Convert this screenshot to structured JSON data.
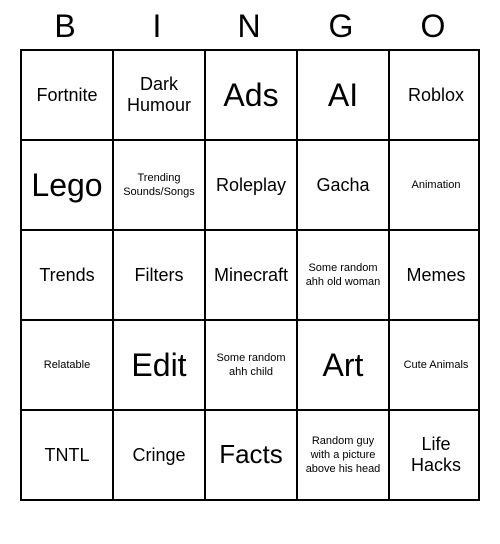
{
  "header": {
    "letters": [
      "B",
      "I",
      "N",
      "G",
      "O"
    ]
  },
  "grid": [
    [
      {
        "text": "Fortnite",
        "size": "medium"
      },
      {
        "text": "Dark Humour",
        "size": "medium"
      },
      {
        "text": "Ads",
        "size": "xlarge"
      },
      {
        "text": "AI",
        "size": "xlarge"
      },
      {
        "text": "Roblox",
        "size": "medium"
      }
    ],
    [
      {
        "text": "Lego",
        "size": "xlarge"
      },
      {
        "text": "Trending Sounds/Songs",
        "size": "small"
      },
      {
        "text": "Roleplay",
        "size": "medium"
      },
      {
        "text": "Gacha",
        "size": "medium"
      },
      {
        "text": "Animation",
        "size": "small"
      }
    ],
    [
      {
        "text": "Trends",
        "size": "medium"
      },
      {
        "text": "Filters",
        "size": "medium"
      },
      {
        "text": "Minecraft",
        "size": "medium"
      },
      {
        "text": "Some random ahh old woman",
        "size": "small"
      },
      {
        "text": "Memes",
        "size": "medium"
      }
    ],
    [
      {
        "text": "Relatable",
        "size": "small"
      },
      {
        "text": "Edit",
        "size": "xlarge"
      },
      {
        "text": "Some random ahh child",
        "size": "small"
      },
      {
        "text": "Art",
        "size": "xlarge"
      },
      {
        "text": "Cute Animals",
        "size": "small"
      }
    ],
    [
      {
        "text": "TNTL",
        "size": "medium"
      },
      {
        "text": "Cringe",
        "size": "medium"
      },
      {
        "text": "Facts",
        "size": "large"
      },
      {
        "text": "Random guy with a picture above his head",
        "size": "small"
      },
      {
        "text": "Life Hacks",
        "size": "medium"
      }
    ]
  ]
}
